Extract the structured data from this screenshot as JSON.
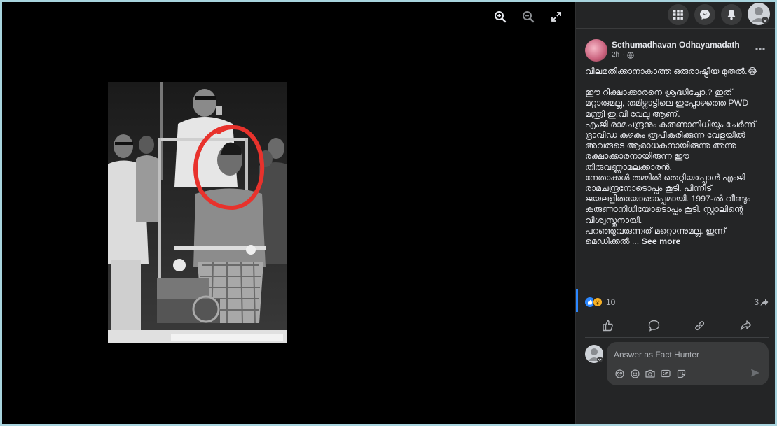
{
  "post": {
    "author": "Sethumadhavan Odhayamadath",
    "time": "2h",
    "paragraphs": [
      "വിലമതിക്കാനാകാത്ത ഒരുരാഷ്ട്രീയ മുതൽ.😂",
      "ഈ റിക്ഷാക്കാരനെ ശ്രദ്ധിച്ചോ.? ഇത് മറ്റാരുമല്ല, തമിഴ്നാട്ടിലെ ഇപ്പോഴത്തെ PWD മന്ത്രി ഇ.വി വേലു ആണ്.",
      "എംജി രാമചന്ദ്രനും കരുണാനിധിയും ചേർന്ന് ദ്രാവിഡ കഴകം രൂപീകരിക്കുന്ന വേളയിൽ അവരുടെ ആരാധകനായിരുന്നു അന്നു രക്ഷാക്കാരനായിരുന്ന ഈ തിരുവണ്ണാമലക്കാരൻ.",
      "നേതാക്കൾ തമ്മിൽ തെറ്റിയപ്പോൾ എംജി രാമചന്ദ്രനോടൊപ്പം കൂടി. പിന്നീട് ജയലളിതയോടൊപ്പമായി. 1997-ൽ വീണ്ടും കരുണാനിധിയോടൊപ്പം കൂടി. സ്റ്റാലിന്റെ വിശ്വസ്തനായി.",
      "പറഞ്ഞുവരുന്നത് മറ്റൊന്നുമല്ല. ഇന്ന് മെഡിക്കൽ ..."
    ],
    "see_more": "See more",
    "reaction_count": "10",
    "share_count": "3"
  },
  "comment": {
    "placeholder": "Answer as Fact Hunter"
  },
  "icons": {
    "zoom_in": "zoom-in-icon",
    "zoom_out": "zoom-out-icon",
    "fullscreen": "expand-icon",
    "menu": "grid-menu-icon",
    "messenger": "messenger-icon",
    "notifications": "bell-icon",
    "like": "thumbs-up-icon",
    "comment": "speech-bubble-icon",
    "link": "link-icon",
    "share": "share-arrow-icon"
  },
  "colors": {
    "panel_bg": "#242526",
    "accent": "#2d88ff",
    "annotation_red": "#e8322c"
  }
}
